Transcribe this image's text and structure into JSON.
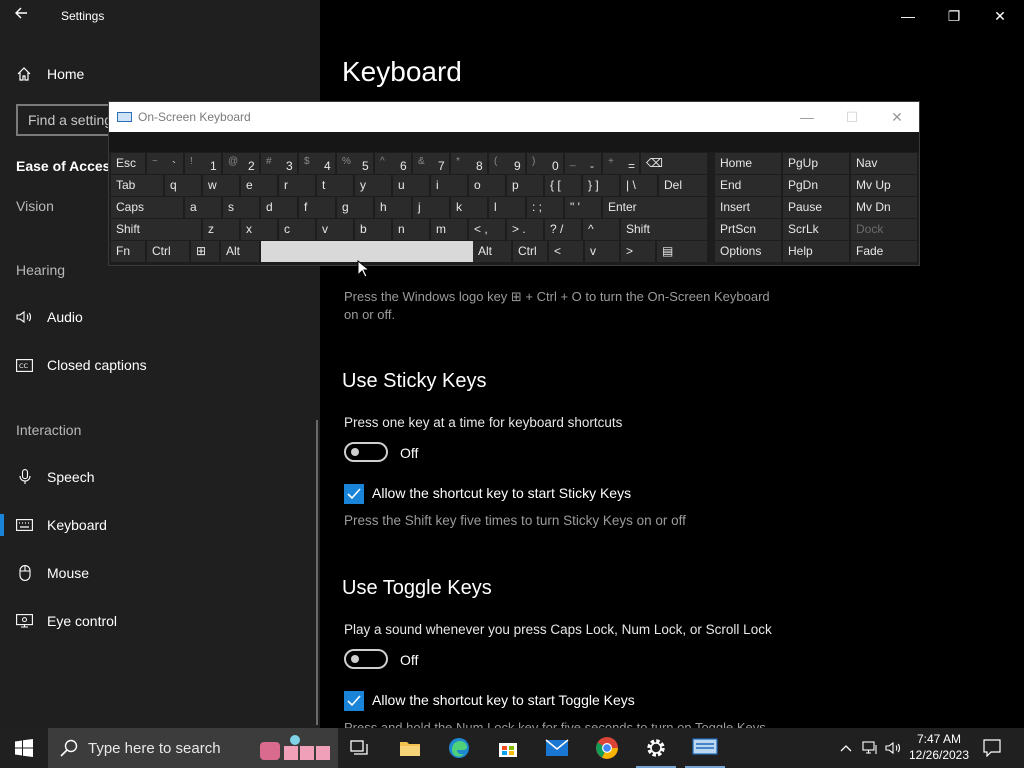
{
  "window": {
    "title": "Settings",
    "back_icon": "back-arrow-icon",
    "minimize": "—",
    "restore": "❐",
    "close": "✕"
  },
  "sidebar": {
    "home": "Home",
    "search_placeholder": "Find a setting",
    "category": "Ease of Access",
    "groups": {
      "vision": "Vision",
      "hearing": "Hearing",
      "interaction": "Interaction"
    },
    "items": [
      {
        "label": "Audio",
        "icon": "speaker-icon"
      },
      {
        "label": "Closed captions",
        "icon": "captions-icon"
      },
      {
        "label": "Speech",
        "icon": "microphone-icon"
      },
      {
        "label": "Keyboard",
        "icon": "keyboard-icon",
        "selected": true
      },
      {
        "label": "Mouse",
        "icon": "mouse-icon"
      },
      {
        "label": "Eye control",
        "icon": "eye-control-icon"
      }
    ],
    "accent_color": "#1a84d8"
  },
  "main": {
    "title": "Keyboard",
    "osk_hint": "Press the Windows logo key ⊞ + Ctrl + O to turn the On-Screen Keyboard on or off.",
    "sticky": {
      "heading": "Use Sticky Keys",
      "description": "Press one key at a time for keyboard shortcuts",
      "toggle_state": "Off",
      "checkbox_label": "Allow the shortcut key to start Sticky Keys",
      "checkbox_checked": true,
      "hint": "Press the Shift key five times to turn Sticky Keys on or off"
    },
    "toggle_keys": {
      "heading": "Use Toggle Keys",
      "description": "Play a sound whenever you press Caps Lock, Num Lock, or Scroll Lock",
      "toggle_state": "Off",
      "checkbox_label": "Allow the shortcut key to start Toggle Keys",
      "checkbox_checked": true,
      "hint": "Press and hold the Num Lock key for five seconds to turn on Toggle Keys"
    }
  },
  "osk": {
    "title": "On-Screen Keyboard",
    "row1": [
      {
        "main": "Esc"
      },
      {
        "shift": "~",
        "main": "`"
      },
      {
        "shift": "!",
        "main": "1"
      },
      {
        "shift": "@",
        "main": "2"
      },
      {
        "shift": "#",
        "main": "3"
      },
      {
        "shift": "$",
        "main": "4"
      },
      {
        "shift": "%",
        "main": "5"
      },
      {
        "shift": "^",
        "main": "6"
      },
      {
        "shift": "&",
        "main": "7"
      },
      {
        "shift": "*",
        "main": "8"
      },
      {
        "shift": "(",
        "main": "9"
      },
      {
        "shift": ")",
        "main": "0"
      },
      {
        "shift": "_",
        "main": "-"
      },
      {
        "shift": "+",
        "main": "="
      },
      {
        "main": "⌫"
      }
    ],
    "row2": [
      "Tab",
      "q",
      "w",
      "e",
      "r",
      "t",
      "y",
      "u",
      "i",
      "o",
      "p",
      "{ [",
      "} ]",
      "| \\",
      "Del"
    ],
    "row3": [
      "Caps",
      "a",
      "s",
      "d",
      "f",
      "g",
      "h",
      "j",
      "k",
      "l",
      ": ;",
      "\" '",
      "Enter"
    ],
    "row4": [
      "Shift",
      "z",
      "x",
      "c",
      "v",
      "b",
      "n",
      "m",
      "< ,",
      "> .",
      "? /",
      "^",
      "Shift"
    ],
    "row5": [
      "Fn",
      "Ctrl",
      "⊞",
      "Alt",
      "",
      "Alt",
      "Ctrl",
      "<",
      "v",
      ">",
      "▤"
    ],
    "nav": [
      [
        "Home",
        "PgUp",
        "Nav"
      ],
      [
        "End",
        "PgDn",
        "Mv Up"
      ],
      [
        "Insert",
        "Pause",
        "Mv Dn"
      ],
      [
        "PrtScn",
        "ScrLk",
        "Dock"
      ],
      [
        "Options",
        "Help",
        "Fade"
      ]
    ]
  },
  "taskbar": {
    "search_placeholder": "Type here to search",
    "time": "7:47 AM",
    "date": "12/26/2023",
    "apps": [
      "task-view-icon",
      "file-explorer-icon",
      "edge-icon",
      "store-icon",
      "mail-icon",
      "chrome-icon",
      "settings-icon",
      "osk-app-icon"
    ]
  }
}
